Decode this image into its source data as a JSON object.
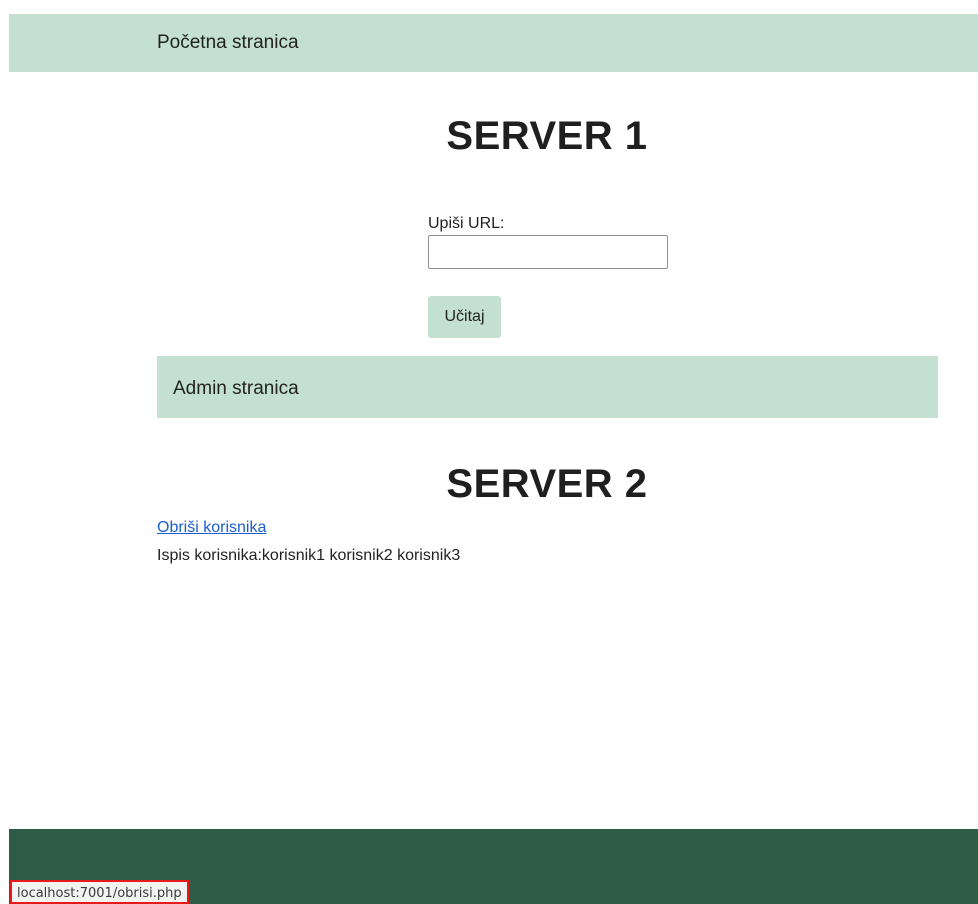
{
  "top_header": {
    "title": "Početna stranica"
  },
  "server1": {
    "title": "SERVER 1",
    "url_label": "Upiši URL:",
    "url_value": "",
    "load_label": "Učitaj"
  },
  "admin_header": {
    "title": "Admin stranica"
  },
  "server2": {
    "title": "SERVER 2",
    "delete_link": "Obriši korisnika",
    "users_prefix": "Ispis korisnika:",
    "users": "korisnik1 korisnik2 korisnik3"
  },
  "status_bar": {
    "url": "localhost:7001/obrisi.php"
  },
  "colors": {
    "header_bg": "#c4e0d2",
    "footer_bg": "#2e5c47",
    "link": "#1a5fd0",
    "highlight_border": "#e51b1b"
  }
}
